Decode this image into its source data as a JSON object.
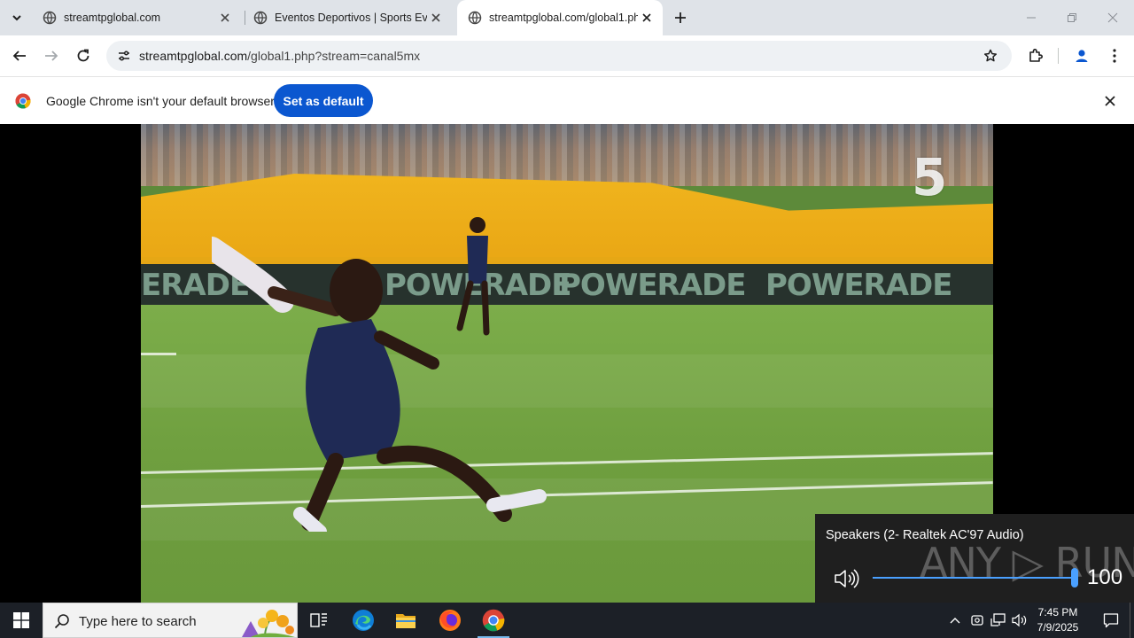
{
  "browser": {
    "tabs": [
      {
        "title": "streamtpglobal.com",
        "active": false
      },
      {
        "title": "Eventos Deportivos | Sports Eve",
        "active": false
      },
      {
        "title": "streamtpglobal.com/global1.ph",
        "active": true
      }
    ],
    "address_bar": {
      "domain": "streamtpglobal.com",
      "path": "/global1.php?stream=canal5mx"
    },
    "infobar": {
      "message": "Google Chrome isn't your default browser",
      "button_label": "Set as default"
    }
  },
  "video": {
    "channel_logo": "5",
    "boards": [
      "ERADE",
      "POWERADE",
      "POWERADE",
      "POWERADE"
    ]
  },
  "volume_flyout": {
    "device": "Speakers (2- Realtek AC'97 Audio)",
    "level": 100,
    "level_text": "100",
    "watermark": "ANY ▷ RUN"
  },
  "taskbar": {
    "search_placeholder": "Type here to search",
    "time": "7:45 PM",
    "date": "7/9/2025"
  },
  "colors": {
    "accent_blue": "#0b57d0",
    "tabstrip": "#dfe3e8",
    "taskbar": "#1c2027",
    "volume_accent": "#4aa0ff"
  },
  "icons": [
    "tab-search-icon",
    "globe-icon",
    "close-icon",
    "plus-icon",
    "minimize-icon",
    "restore-icon",
    "back-icon",
    "forward-icon",
    "reload-icon",
    "site-info-icon",
    "star-icon",
    "extensions-icon",
    "profile-icon",
    "menu-icon",
    "chrome-logo-icon",
    "speaker-icon",
    "windows-start-icon",
    "search-icon",
    "task-view-icon",
    "edge-icon",
    "file-explorer-icon",
    "firefox-icon",
    "chrome-icon",
    "chevron-up-icon",
    "meet-icon",
    "network-icon",
    "volume-icon",
    "notification-icon"
  ]
}
